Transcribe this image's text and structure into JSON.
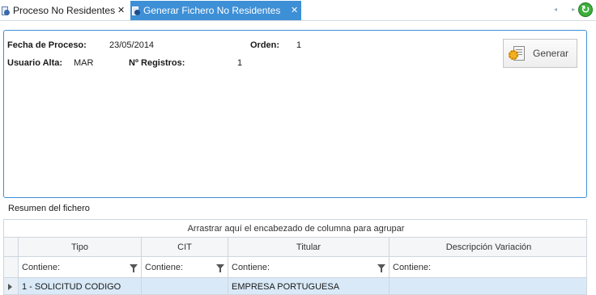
{
  "tabs": [
    {
      "label": "Proceso No Residentes",
      "close": "✕"
    },
    {
      "label": "Generar Fichero No Residentes",
      "close": "✕"
    }
  ],
  "toolbar": {
    "scroll_arrows": "◂ ▸",
    "refresh_icon": "refresh-icon"
  },
  "process": {
    "fecha_label": "Fecha de Proceso:",
    "fecha_value": "23/05/2014",
    "orden_label": "Orden:",
    "orden_value": "1",
    "usuario_label": "Usuario Alta:",
    "usuario_value": "MAR",
    "registros_label": "Nº Registros:",
    "registros_value": "1",
    "generar_label": "Generar"
  },
  "summary": {
    "title": "Resumen del fichero",
    "group_hint": "Arrastrar aquí el encabezado de columna para agrupar",
    "columns": [
      "Tipo",
      "CIT",
      "Titular",
      "Descripción Variación"
    ],
    "filter_label": "Contiene:",
    "rows": [
      [
        "1 - SOLICITUD CODIGO",
        "",
        "EMPRESA PORTUGUESA",
        ""
      ]
    ]
  },
  "colors": {
    "accent": "#3d8fd6",
    "selected_row": "#d9e9f7",
    "border": "#cfd6df"
  }
}
